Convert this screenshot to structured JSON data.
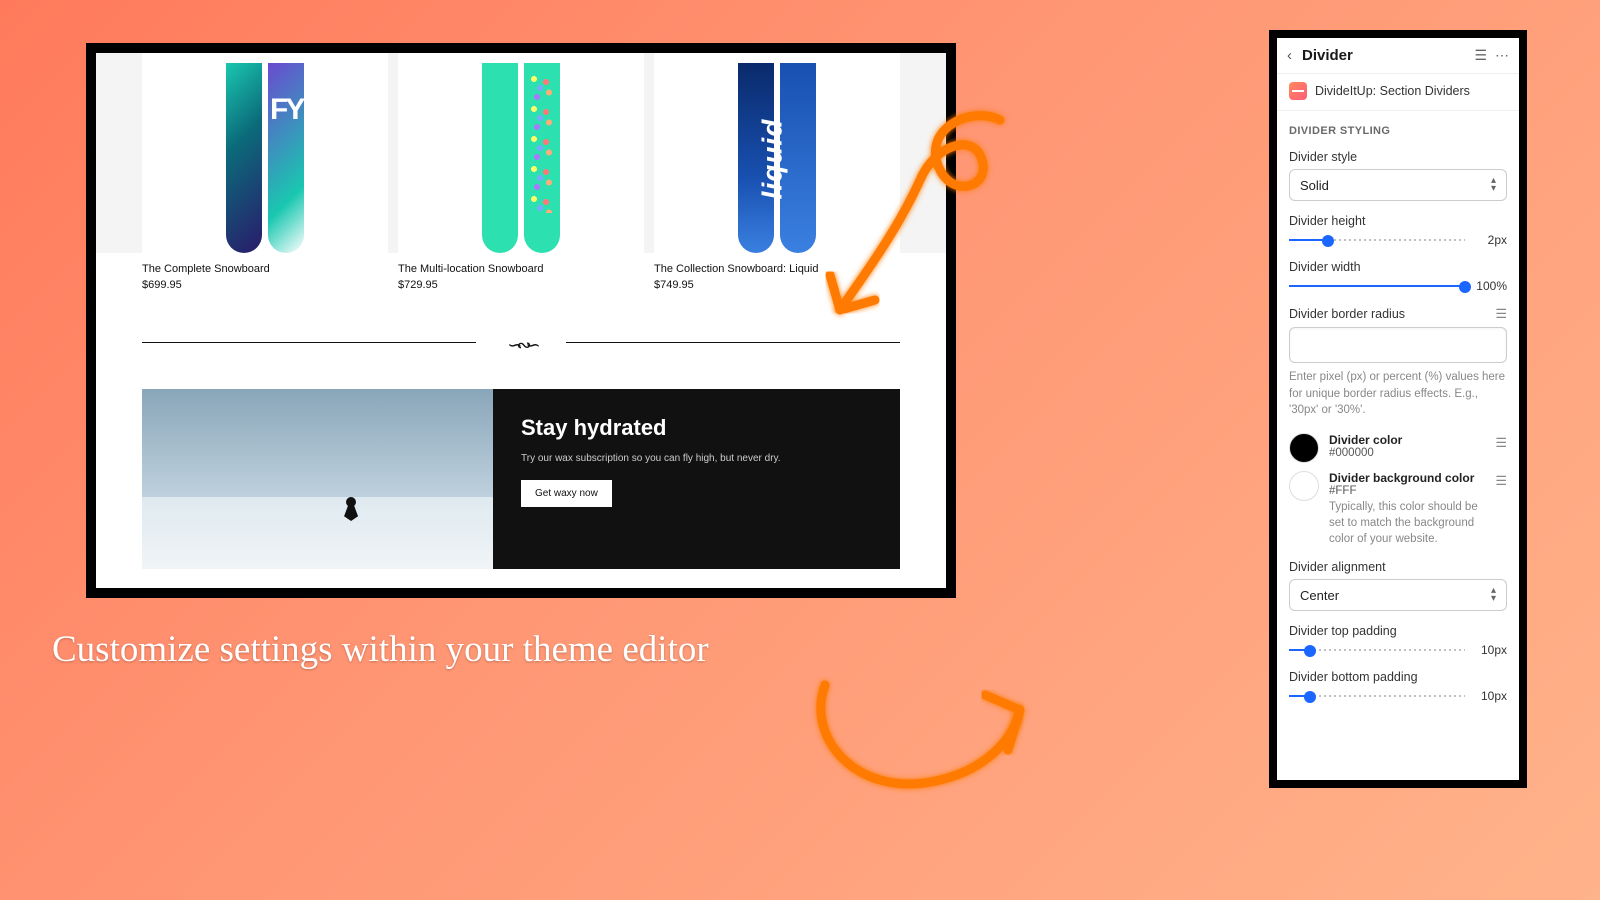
{
  "caption": "Customize settings within your theme editor",
  "preview": {
    "products": [
      {
        "title": "The Complete Snowboard",
        "price": "$699.95"
      },
      {
        "title": "The Multi-location Snowboard",
        "price": "$729.95"
      },
      {
        "title": "The Collection Snowboard: Liquid",
        "price": "$749.95"
      }
    ],
    "hero": {
      "heading": "Stay hydrated",
      "sub": "Try our wax subscription so you can fly high, but never dry.",
      "cta": "Get waxy now"
    }
  },
  "panel": {
    "title": "Divider",
    "app_name": "DivideItUp: Section Dividers",
    "section_heading": "DIVIDER STYLING",
    "fields": {
      "style_label": "Divider style",
      "style_value": "Solid",
      "height_label": "Divider height",
      "height_value": "2px",
      "height_pct": 22,
      "width_label": "Divider width",
      "width_value": "100%",
      "width_pct": 100,
      "radius_label": "Divider border radius",
      "radius_value": "",
      "radius_help": "Enter pixel (px) or percent (%) values here for unique border radius effects. E.g., '30px' or '30%'.",
      "color_label": "Divider color",
      "color_hex": "#000000",
      "bgcolor_label": "Divider background color",
      "bgcolor_hex": "#FFF",
      "bgcolor_help": "Typically, this color should be set to match the background color of your website.",
      "align_label": "Divider alignment",
      "align_value": "Center",
      "tpad_label": "Divider top padding",
      "tpad_value": "10px",
      "tpad_pct": 12,
      "bpad_label": "Divider bottom padding",
      "bpad_value": "10px",
      "bpad_pct": 12
    }
  }
}
